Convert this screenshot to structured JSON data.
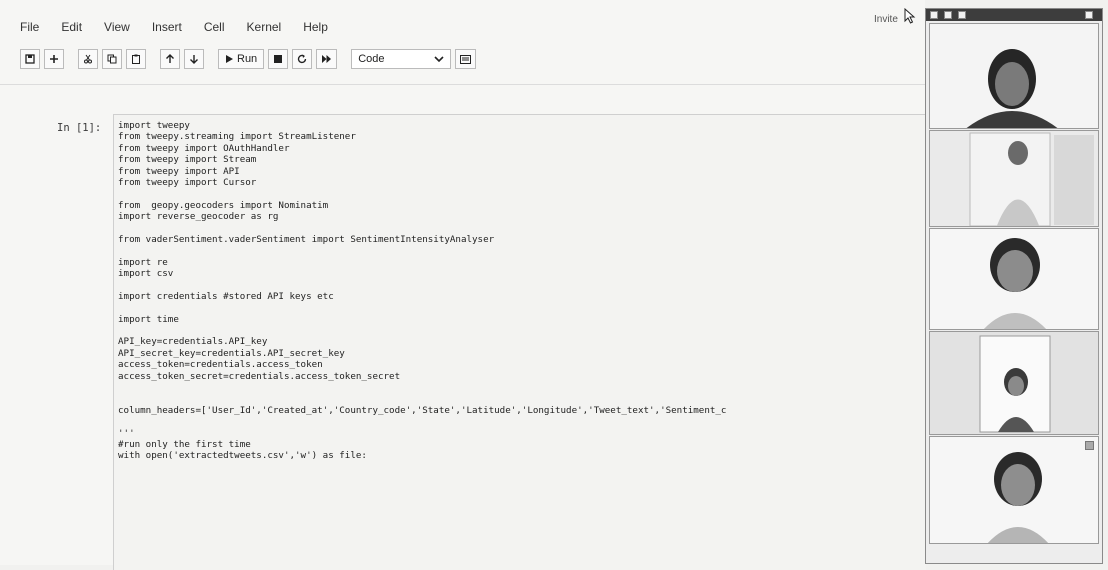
{
  "menu": [
    "File",
    "Edit",
    "View",
    "Insert",
    "Cell",
    "Kernel",
    "Help"
  ],
  "invite_label": "Invite",
  "toolbar": {
    "run_label": "Run",
    "cell_type": "Code",
    "icons": [
      "save-icon",
      "add-icon",
      "cut-icon",
      "copy-icon",
      "paste-icon",
      "move-up-icon",
      "move-down-icon",
      "play-icon",
      "stop-icon",
      "restart-icon",
      "fast-forward-icon",
      "command-palette-icon"
    ]
  },
  "cell": {
    "prompt": "In [1]:",
    "lines": [
      "import tweepy",
      "from tweepy.streaming import StreamListener",
      "from tweepy import OAuthHandler",
      "from tweepy import Stream",
      "from tweepy import API",
      "from tweepy import Cursor",
      "",
      "from  geopy.geocoders import Nominatim",
      "import reverse_geocoder as rg",
      "",
      "from vaderSentiment.vaderSentiment import SentimentIntensityAnalyser",
      "",
      "import re",
      "import csv",
      "",
      "import credentials #stored API keys etc",
      "",
      "import time",
      "",
      "API_key=credentials.API_key",
      "API_secret_key=credentials.API_secret_key",
      "access_token=credentials.access_token",
      "access_token_secret=credentials.access_token_secret",
      "",
      "",
      "column_headers=['User_Id','Created_at','Country_code','State','Latitude','Longitude','Tweet_text','Sentiment_c",
      "",
      "'''",
      "#run only the first time",
      "with open('extractedtweets.csv','w') as file:"
    ]
  },
  "video_panel": {
    "participants": [
      "",
      "",
      "",
      "",
      ""
    ]
  },
  "colors": {
    "titlebar": "#3d3d3d",
    "background": "#f6f6f4"
  }
}
